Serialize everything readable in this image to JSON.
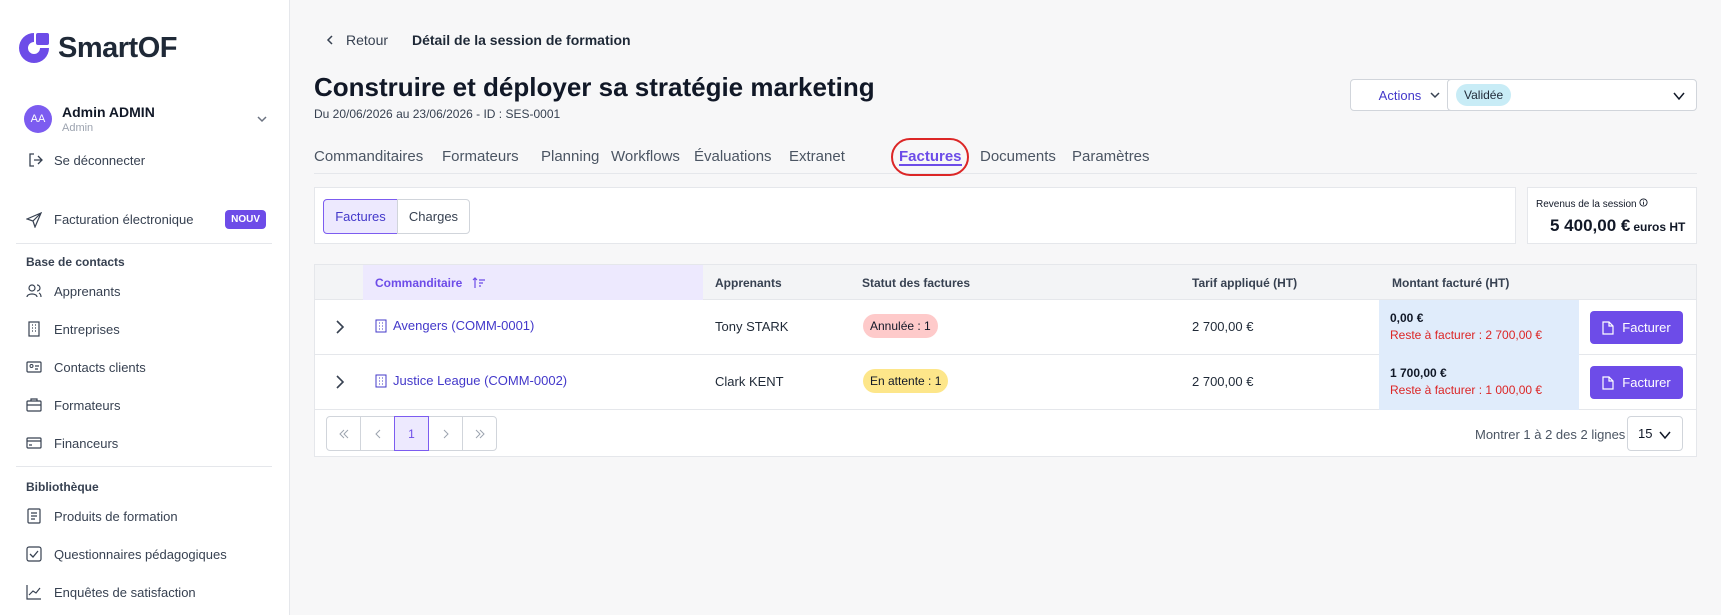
{
  "brand": {
    "name": "SmartOF"
  },
  "user": {
    "initials": "AA",
    "name": "Admin ADMIN",
    "role": "Admin",
    "logout": "Se déconnecter"
  },
  "sidebar": {
    "billing": {
      "label": "Facturation électronique",
      "badge": "NOUV"
    },
    "contacts_title": "Base de contacts",
    "contacts": [
      "Apprenants",
      "Entreprises",
      "Contacts clients",
      "Formateurs",
      "Financeurs"
    ],
    "library_title": "Bibliothèque",
    "library": [
      "Produits de formation",
      "Questionnaires pédagogiques",
      "Enquêtes de satisfaction"
    ]
  },
  "header": {
    "back": "Retour",
    "breadcrumb": "Détail de la session de formation",
    "title": "Construire et déployer sa stratégie marketing",
    "subtitle": "Du 20/06/2026 au 23/06/2026 - ID : SES-0001",
    "actions": "Actions",
    "status": "Validée"
  },
  "tabs": [
    "Commanditaires",
    "Formateurs",
    "Planning",
    "Workflows",
    "Évaluations",
    "Extranet",
    "Factures",
    "Documents",
    "Paramètres"
  ],
  "active_tab": "Factures",
  "segments": {
    "invoices": "Factures",
    "charges": "Charges"
  },
  "revenue": {
    "label": "Revenus de la session",
    "value": "5 400,00 €",
    "unit": "euros HT"
  },
  "table": {
    "headers": {
      "sponsor": "Commanditaire",
      "learners": "Apprenants",
      "status": "Statut des factures",
      "rate": "Tarif appliqué (HT)",
      "billed": "Montant facturé (HT)"
    },
    "rows": [
      {
        "sponsor": "Avengers (COMM-0001)",
        "learner": "Tony STARK",
        "status": "Annulée : 1",
        "rate": "2 700,00 €",
        "billed": "0,00 €",
        "remaining": "Reste à facturer : 2 700,00 €",
        "action": "Facturer"
      },
      {
        "sponsor": "Justice League (COMM-0002)",
        "learner": "Clark KENT",
        "status": "En attente : 1",
        "rate": "2 700,00 €",
        "billed": "1 700,00 €",
        "remaining": "Reste à facturer : 1 000,00 €",
        "action": "Facturer"
      }
    ],
    "pagination": {
      "current": "1",
      "info": "Montrer 1 à 2 des 2 lignes",
      "page_size": "15"
    }
  },
  "colors": {
    "accent": "#6d4ce8",
    "danger": "#dc2626",
    "cancelled": "#fecaca",
    "pending": "#fde68a",
    "validated": "#c8ecf6"
  }
}
